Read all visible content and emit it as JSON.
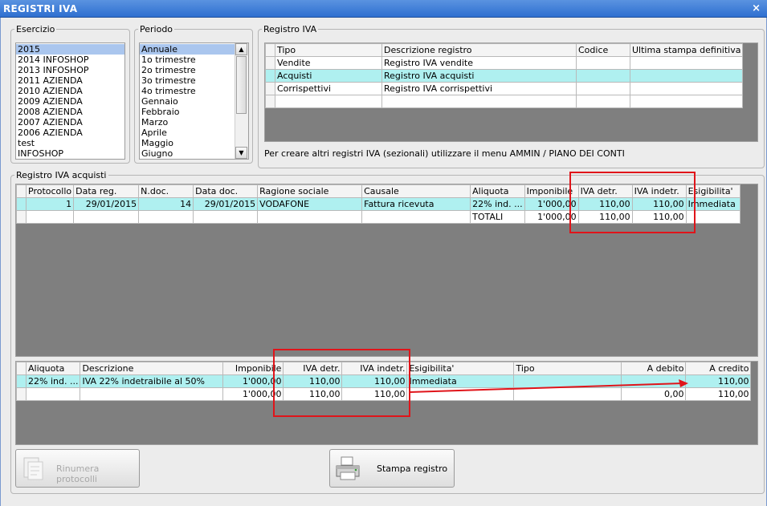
{
  "window": {
    "title": "REGISTRI IVA",
    "close_label": "×"
  },
  "esercizio": {
    "legend": "Esercizio",
    "items": [
      "2015",
      "2014 INFOSHOP",
      "2013 INFOSHOP",
      "2011 AZIENDA",
      "2010 AZIENDA",
      "2009 AZIENDA",
      "2008 AZIENDA",
      "2007 AZIENDA",
      "2006 AZIENDA",
      "test",
      "INFOSHOP"
    ],
    "selected": "2015"
  },
  "periodo": {
    "legend": "Periodo",
    "items": [
      "Annuale",
      "1o trimestre",
      "2o trimestre",
      "3o trimestre",
      "4o trimestre",
      "Gennaio",
      "Febbraio",
      "Marzo",
      "Aprile",
      "Maggio",
      "Giugno"
    ],
    "selected": "Annuale"
  },
  "registro_iva": {
    "legend": "Registro IVA",
    "headers": [
      "Tipo",
      "Descrizione registro",
      "Codice",
      "Ultima stampa definitiva"
    ],
    "rows": [
      [
        "Vendite",
        "Registro IVA vendite",
        "",
        ""
      ],
      [
        "Acquisti",
        "Registro IVA acquisti",
        "",
        ""
      ],
      [
        "Corrispettivi",
        "Registro IVA corrispettivi",
        "",
        ""
      ]
    ],
    "note": "Per creare altri registri IVA (sezionali) utilizzare il menu AMMIN / PIANO DEI CONTI"
  },
  "acquisti": {
    "legend": "Registro IVA acquisti",
    "headers": [
      "Protocollo",
      "Data reg.",
      "N.doc.",
      "Data doc.",
      "Ragione sociale",
      "Causale",
      "Aliquota",
      "Imponibile",
      "IVA detr.",
      "IVA indetr.",
      "Esigibilita'"
    ],
    "rows": [
      [
        "1",
        "29/01/2015",
        "14",
        "29/01/2015",
        "VODAFONE",
        "Fattura ricevuta",
        "22% ind. ...",
        "1'000,00",
        "110,00",
        "110,00",
        "Immediata"
      ]
    ],
    "totals": {
      "label": "TOTALI",
      "imponibile": "1'000,00",
      "iva_detr": "110,00",
      "iva_indetr": "110,00"
    }
  },
  "riepilogo": {
    "headers": [
      "Aliquota",
      "Descrizione",
      "Imponibile",
      "IVA detr.",
      "IVA indetr.",
      "Esigibilita'",
      "Tipo",
      "A debito",
      "A credito"
    ],
    "rows": [
      [
        "22% ind. ...",
        "IVA 22% indetraibile al 50%",
        "1'000,00",
        "110,00",
        "110,00",
        "Immediata",
        "",
        "",
        "110,00"
      ]
    ],
    "totals": {
      "imponibile": "1'000,00",
      "iva_detr": "110,00",
      "iva_indetr": "110,00",
      "a_debito": "0,00",
      "a_credito": "110,00"
    }
  },
  "buttons": {
    "rinumera": "Rinumera protocolli",
    "stampa": "Stampa registro"
  },
  "colors": {
    "highlight_row": "#aff0f0",
    "selected_item": "#aac6ee",
    "annotation_red": "#e0141a"
  }
}
